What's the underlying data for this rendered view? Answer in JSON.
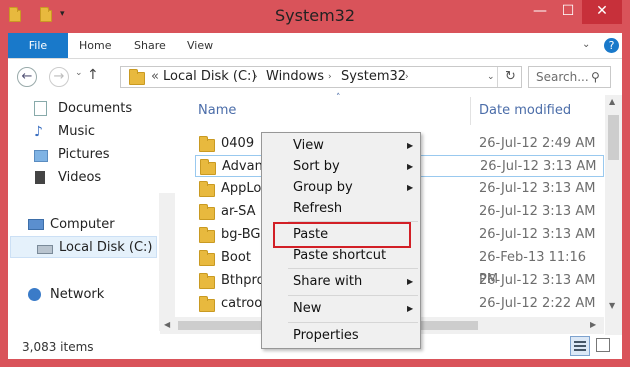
{
  "window": {
    "title": "System32"
  },
  "titlebar": {
    "minimize": "—",
    "maximize": "☐",
    "close": "✕"
  },
  "ribbon": {
    "tabs": [
      "File",
      "Home",
      "Share",
      "View"
    ]
  },
  "nav": {
    "back": "←",
    "forward": "→",
    "up": "↑",
    "recent": "⌄",
    "breadcrumb": [
      "«",
      "Local Disk (C:)",
      "Windows",
      "System32"
    ],
    "search_placeholder": "Search..."
  },
  "sidebar": {
    "items": [
      "Documents",
      "Music",
      "Pictures",
      "Videos",
      "Computer",
      "Local Disk (C:)",
      "Network"
    ]
  },
  "files": {
    "columns": [
      "Name",
      "Date modified"
    ],
    "rows": [
      {
        "name": "0409",
        "date": "26-Jul-12 2:49 AM"
      },
      {
        "name": "Advanc",
        "date": "26-Jul-12 3:13 AM"
      },
      {
        "name": "AppLoc",
        "date": "26-Jul-12 3:13 AM"
      },
      {
        "name": "ar-SA",
        "date": "26-Jul-12 3:13 AM"
      },
      {
        "name": "bg-BG",
        "date": "26-Jul-12 3:13 AM"
      },
      {
        "name": "Boot",
        "date": "26-Feb-13 11:16 PM"
      },
      {
        "name": "Bthprop",
        "date": "26-Jul-12 3:13 AM"
      },
      {
        "name": "catroot",
        "date": "26-Jul-12 2:22 AM"
      }
    ]
  },
  "context_menu": {
    "items": [
      "View",
      "Sort by",
      "Group by",
      "Refresh",
      "Paste",
      "Paste shortcut",
      "Share with",
      "New",
      "Properties"
    ]
  },
  "status": {
    "count": "3,083 items"
  },
  "colors": {
    "title_bg": "#d9535a",
    "file_tab": "#1979ca",
    "highlight": "#d21f26",
    "folder": "#e8b93e"
  }
}
